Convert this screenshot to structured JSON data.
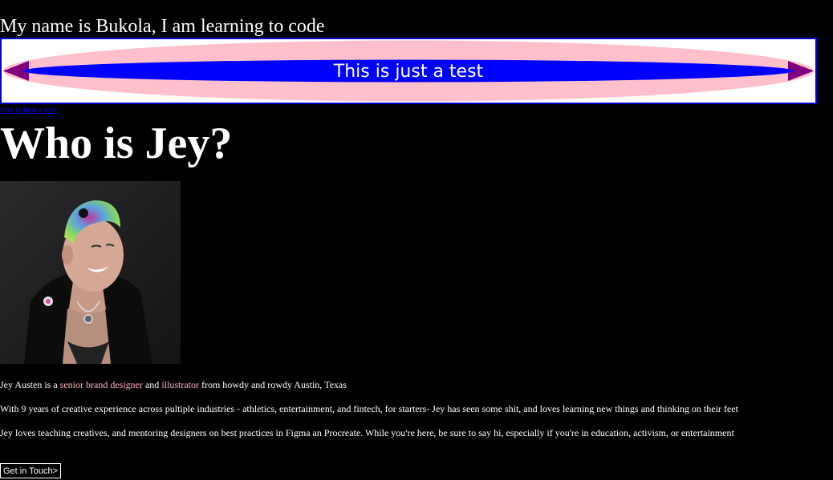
{
  "header": {
    "intro_text": "My name is Bukola, I am learning to code"
  },
  "banner": {
    "text": "This is just a test",
    "colors": {
      "outer_ellipse": "#ffc0cb",
      "inner_ellipse": "#0000ff",
      "end_caps": "#800080",
      "border": "#0000cc",
      "background": "#ffffff"
    }
  },
  "small_link": {
    "label": "this is just a test"
  },
  "main": {
    "heading": "Who is Jey?",
    "photo_description": "portrait-photo",
    "paragraphs": {
      "p1": {
        "before": "Jey Austen is a ",
        "link1": "senior brand designer",
        "middle": " and ",
        "link2": "illustrator",
        "after": " from howdy and rowdy Austin, Texas"
      },
      "p2": "With 9 years of creative experience across pultiple industries - athletics, entertainment, and fintech, for starters- Jey has seen some shit, and loves learning new things and thinking on their feet",
      "p3": "Jey loves teaching creatives, and mentoring designers on best practices in Figma an Procreate. While you're here, be sure to say hi, especially if you're in education, activism, or entertainment"
    },
    "cta_label": "Get in Touch>",
    "highlight_color": "#ffb6c1"
  }
}
